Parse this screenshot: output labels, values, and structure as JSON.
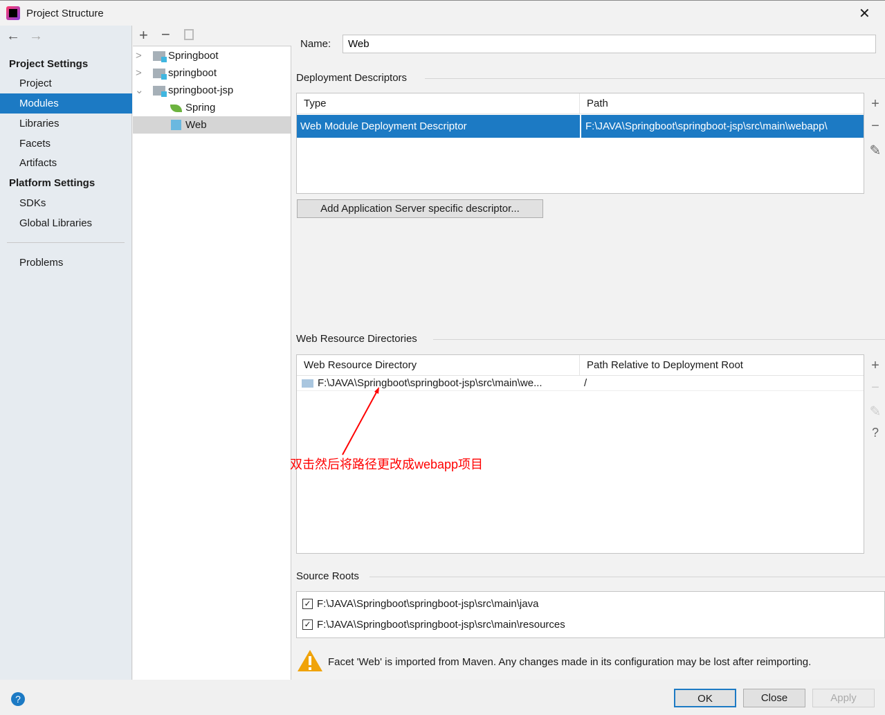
{
  "window": {
    "title": "Project Structure"
  },
  "sidebar": {
    "project_settings": "Project Settings",
    "items": [
      "Project",
      "Modules",
      "Libraries",
      "Facets",
      "Artifacts"
    ],
    "platform_settings": "Platform Settings",
    "platform_items": [
      "SDKs",
      "Global Libraries"
    ],
    "problems": "Problems"
  },
  "tree": {
    "nodes": [
      "Springboot",
      "springboot",
      "springboot-jsp",
      "Spring",
      "Web"
    ]
  },
  "name_field": {
    "label": "Name:",
    "value": "Web"
  },
  "deployment": {
    "title": "Deployment Descriptors",
    "columns": [
      "Type",
      "Path"
    ],
    "rows": [
      {
        "type": "Web Module Deployment Descriptor",
        "path": "F:\\JAVA\\Springboot\\springboot-jsp\\src\\main\\webapp\\"
      }
    ],
    "add_button": "Add Application Server specific descriptor..."
  },
  "web_resources": {
    "title": "Web Resource Directories",
    "columns": [
      "Web Resource Directory",
      "Path Relative to Deployment Root"
    ],
    "rows": [
      {
        "dir": "F:\\JAVA\\Springboot\\springboot-jsp\\src\\main\\we...",
        "path": "/"
      }
    ]
  },
  "annotation": {
    "text": "双击然后将路径更改成webapp项目",
    "color": "#ff0000"
  },
  "source_roots": {
    "title": "Source Roots",
    "items": [
      "F:\\JAVA\\Springboot\\springboot-jsp\\src\\main\\java",
      "F:\\JAVA\\Springboot\\springboot-jsp\\src\\main\\resources"
    ]
  },
  "warning": "Facet 'Web' is imported from Maven. Any changes made in its configuration may be lost after reimporting.",
  "buttons": {
    "ok": "OK",
    "close": "Close",
    "apply": "Apply"
  },
  "colors": {
    "selection": "#1c7ac4",
    "accent": "#2675bf"
  }
}
